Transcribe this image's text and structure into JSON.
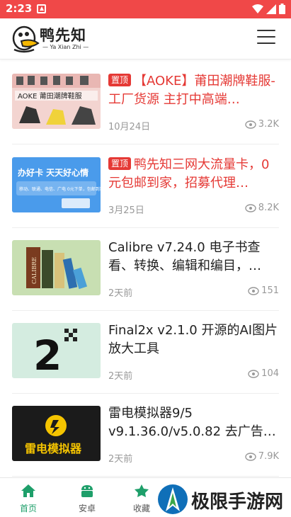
{
  "status_bar": {
    "time": "2:23"
  },
  "header": {
    "brand": "鸭先知",
    "brand_sub": "— Ya Xian Zhi —"
  },
  "feed": {
    "pin_label": "置顶",
    "items": [
      {
        "pinned": true,
        "title": "【AOKE】莆田潮牌鞋服-工厂货源 主打中高端…",
        "date": "10月24日",
        "views": "3.2K",
        "thumb_text": "AOKE 莆田潮牌鞋服"
      },
      {
        "pinned": true,
        "title": "鸭先知三网大流量卡，0元包邮到家，招募代理…",
        "date": "3月25日",
        "views": "8.2K",
        "thumb_text": "办好卡 天天好心情",
        "thumb_sub": "移动、联通、电信、广电 0元下单，包邮到家！"
      },
      {
        "pinned": false,
        "title": "Calibre v7.24.0 电子书查看、转换、编辑和编目，…",
        "date": "2天前",
        "views": "151",
        "thumb_text": "CALIBRE"
      },
      {
        "pinned": false,
        "title": "Final2x v2.1.0 开源的AI图片放大工具",
        "date": "2天前",
        "views": "104",
        "thumb_text": "2"
      },
      {
        "pinned": false,
        "title": "雷电模拟器9/5 v9.1.36.0/v5.0.82 去广告…",
        "date": "2天前",
        "views": "7.9K",
        "thumb_text": "雷电模拟器"
      }
    ]
  },
  "tabbar": {
    "tabs": [
      {
        "label": "首页",
        "icon": "home-icon"
      },
      {
        "label": "安卓",
        "icon": "android-icon"
      },
      {
        "label": "收藏",
        "icon": "star-icon"
      }
    ]
  },
  "watermark": {
    "text": "极限手游网"
  },
  "colors": {
    "status_bar": "#f04848",
    "accent_red": "#e53935",
    "tab_active": "#1e9f6a"
  }
}
